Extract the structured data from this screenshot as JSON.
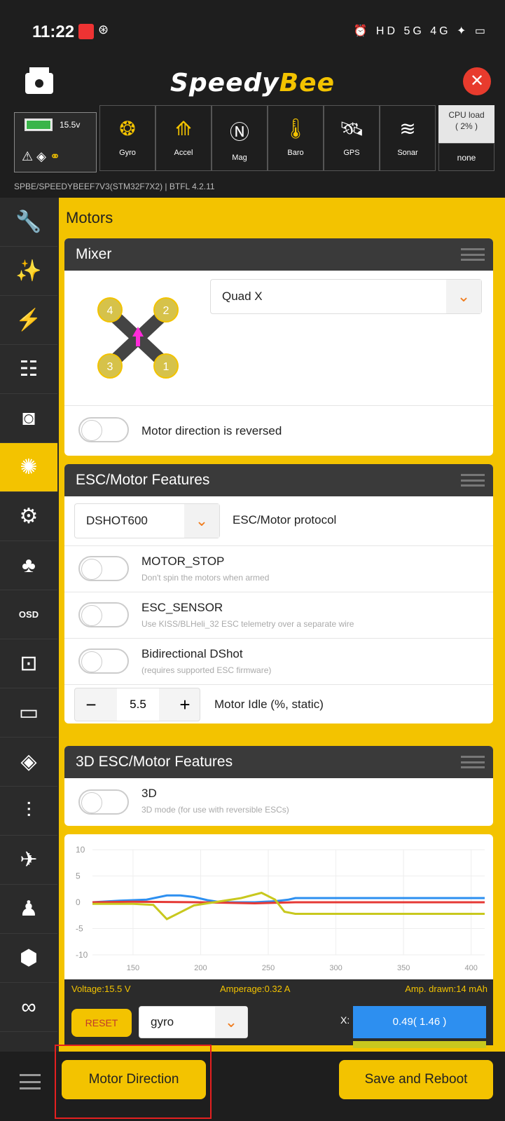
{
  "status": {
    "time": "11:22",
    "right_icons": "⏰ HD 5G 4G ✦ ▭"
  },
  "app": {
    "logo_prefix": "Speedy",
    "logo_suffix": "Bee"
  },
  "battery": {
    "voltage": "15.5v"
  },
  "sensors": [
    {
      "label": "Gyro",
      "icon": "gyro-icon"
    },
    {
      "label": "Accel",
      "icon": "accel-icon"
    },
    {
      "label": "Mag",
      "icon": "mag-icon"
    },
    {
      "label": "Baro",
      "icon": "baro-icon"
    },
    {
      "label": "GPS",
      "icon": "gps-icon"
    },
    {
      "label": "Sonar",
      "icon": "sonar-icon"
    }
  ],
  "cpu": {
    "title": "CPU load",
    "value": "( 2% )",
    "none": "none"
  },
  "firmware": "SPBE/SPEEDYBEEF7V3(STM32F7X2)   |   BTFL 4.2.11",
  "page_title": "Motors",
  "mixer": {
    "title": "Mixer",
    "selected": "Quad X",
    "motor_direction_label": "Motor direction is reversed",
    "motor_labels": [
      "4",
      "2",
      "3",
      "1"
    ]
  },
  "esc": {
    "title": "ESC/Motor Features",
    "protocol_value": "DSHOT600",
    "protocol_label": "ESC/Motor protocol",
    "motor_stop": {
      "title": "MOTOR_STOP",
      "desc": "Don't spin the motors when armed"
    },
    "esc_sensor": {
      "title": "ESC_SENSOR",
      "desc": "Use KISS/BLHeli_32 ESC telemetry over a separate wire"
    },
    "bidir": {
      "title": "Bidirectional DShot",
      "desc": "(requires supported ESC firmware)"
    },
    "idle_value": "5.5",
    "idle_label": "Motor Idle (%, static)",
    "minus": "−",
    "plus": "+"
  },
  "esc3d": {
    "title": "3D ESC/Motor Features",
    "label": "3D",
    "desc": "3D mode (for use with reversible ESCs)"
  },
  "chart_data": {
    "type": "line",
    "y_ticks": [
      "10",
      "5",
      "0",
      "-5",
      "-10"
    ],
    "x_ticks": [
      "150",
      "200",
      "250",
      "300",
      "350",
      "400"
    ],
    "ylim": [
      -10,
      10
    ],
    "xlim": [
      120,
      410
    ],
    "series": [
      {
        "color": "#2d8ff0",
        "x": [
          120,
          140,
          160,
          175,
          185,
          195,
          205,
          215,
          225,
          240,
          255,
          265,
          270,
          410
        ],
        "y": [
          0,
          0.3,
          0.5,
          1.3,
          1.3,
          1.0,
          0.4,
          0,
          0,
          0,
          0.2,
          0.5,
          0.8,
          0.8
        ]
      },
      {
        "color": "#e53935",
        "x": [
          120,
          150,
          200,
          240,
          270,
          410
        ],
        "y": [
          0,
          0.1,
          0,
          -0.2,
          0,
          0
        ]
      },
      {
        "color": "#c8c81e",
        "x": [
          120,
          150,
          165,
          175,
          195,
          215,
          230,
          245,
          255,
          262,
          270,
          410
        ],
        "y": [
          -0.3,
          -0.3,
          -0.5,
          -3.2,
          -0.6,
          0.2,
          0.8,
          1.8,
          0.5,
          -1.8,
          -2.2,
          -2.2
        ]
      }
    ]
  },
  "telemetry": {
    "voltage": "Voltage:15.5 V",
    "amperage": "Amperage:0.32 A",
    "drawn": "Amp. drawn:14 mAh"
  },
  "axis": {
    "reset": "RESET",
    "source": "gyro",
    "x_label": "X:",
    "x_value": "0.49( 1.46 )"
  },
  "bottom": {
    "motor_direction": "Motor Direction",
    "save_reboot": "Save and Reboot"
  },
  "colors": {
    "accent": "#f3c300",
    "dark": "#1e1e1e",
    "highlight": "#e52020"
  }
}
